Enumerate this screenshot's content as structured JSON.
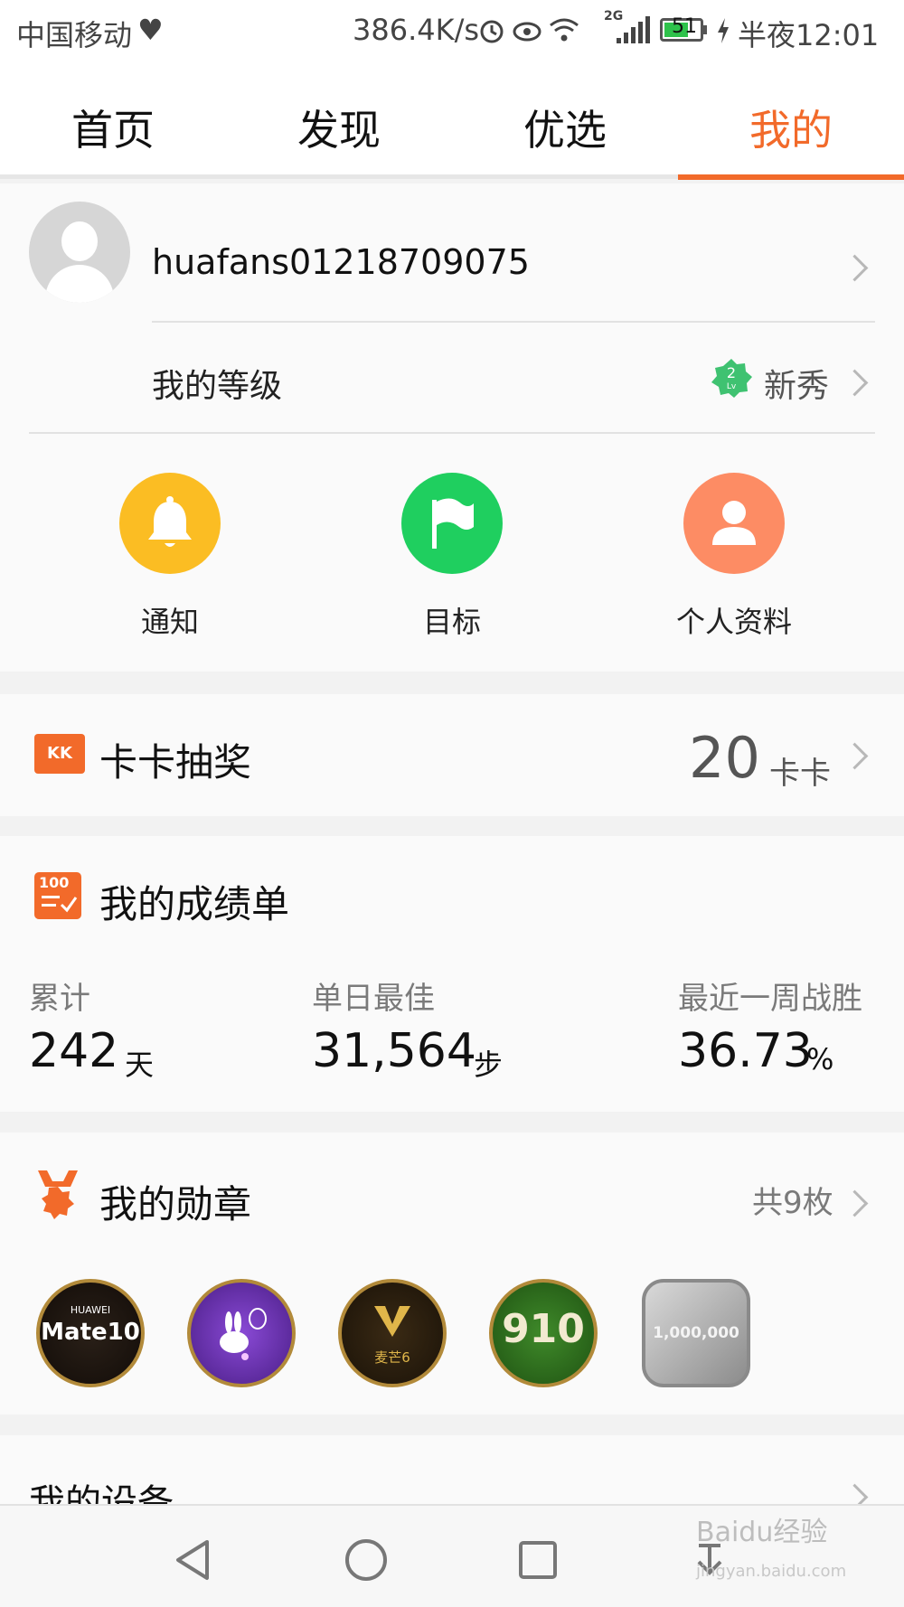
{
  "status_bar": {
    "carrier": "中国移动",
    "net_speed": "386.4K/s",
    "network_type": "2G",
    "battery": "51",
    "time": "半夜12:01"
  },
  "tabs": [
    {
      "label": "首页"
    },
    {
      "label": "发现"
    },
    {
      "label": "优选"
    },
    {
      "label": "我的"
    }
  ],
  "profile": {
    "username": "huafans01218709075",
    "level_label": "我的等级",
    "level_number": "2",
    "level_badge_text": "Lv",
    "level_name": "新秀"
  },
  "quick_actions": [
    {
      "label": "通知",
      "icon": "bell-icon",
      "color": "#fbbd23"
    },
    {
      "label": "目标",
      "icon": "flag-icon",
      "color": "#1fcf5f"
    },
    {
      "label": "个人资料",
      "icon": "person-icon",
      "color": "#fd8c64"
    }
  ],
  "kaka": {
    "icon_text": "KK",
    "title": "卡卡抽奖",
    "count": "20",
    "unit": "卡卡"
  },
  "report": {
    "icon_text": "100",
    "title": "我的成绩单",
    "stats": [
      {
        "label": "累计",
        "value": "242",
        "unit": "天"
      },
      {
        "label": "单日最佳",
        "value": "31,564",
        "unit": "步"
      },
      {
        "label": "最近一周战胜",
        "value": "36.73",
        "unit": "%"
      }
    ]
  },
  "medals": {
    "title": "我的勋章",
    "total": "共9枚",
    "items": [
      {
        "brand": "HUAWEI",
        "text": "Mate10",
        "color": "#1b1410"
      },
      {
        "text": "",
        "color": "#5a2a9a"
      },
      {
        "text": "麦芒6",
        "color": "#2b1d10"
      },
      {
        "text": "910",
        "color": "#2e6b1e"
      },
      {
        "text": "1,000,000",
        "color": "#a9a9a9"
      }
    ]
  },
  "devices": {
    "title": "我的设备"
  },
  "watermark": {
    "logo": "Baidu经验",
    "url": "jingyan.baidu.com"
  },
  "colors": {
    "accent": "#f26a2a"
  }
}
